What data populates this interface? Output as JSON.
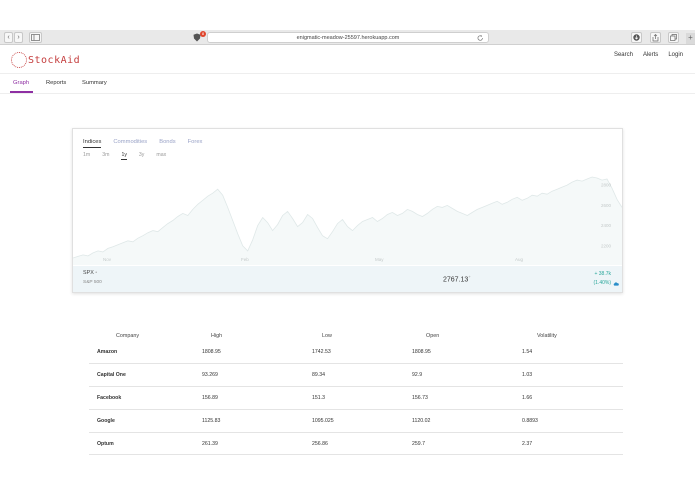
{
  "browser": {
    "url": "enigmatic-meadow-25597.herokuapp.com",
    "badge_count": "8",
    "back_glyph": "‹",
    "forward_glyph": "›",
    "new_tab_glyph": "+"
  },
  "app": {
    "logo_text": "StockAid",
    "top_links": [
      "Search",
      "Alerts",
      "Login"
    ]
  },
  "nav": {
    "tabs": [
      "Graph",
      "Reports",
      "Summary"
    ],
    "active_tab": "Graph"
  },
  "chart_card": {
    "categories": [
      "Indices",
      "Commodities",
      "Bonds",
      "Forex"
    ],
    "active_category": "Indices",
    "ranges": [
      "1m",
      "3m",
      "1y",
      "3y",
      "max"
    ],
    "active_range": "1y",
    "symbol": "SPX",
    "symbol_marker": "•",
    "symbol_name": "S&P 500",
    "last_price": "2767.13",
    "price_marker": "+",
    "change": "+ 38.7k",
    "change_pct": "(1.40%)",
    "accent_color": "#2aa79b"
  },
  "chart_data": {
    "type": "area",
    "title": "",
    "x_tick_labels": [
      "Nov",
      "Feb",
      "May",
      "Aug"
    ],
    "y_tick_labels": [
      "2800",
      "2600",
      "2400",
      "2200"
    ],
    "ylim": [
      2050,
      2900
    ],
    "values": [
      2080,
      2095,
      2110,
      2100,
      2130,
      2150,
      2140,
      2175,
      2190,
      2210,
      2230,
      2250,
      2240,
      2275,
      2300,
      2330,
      2350,
      2340,
      2380,
      2420,
      2450,
      2490,
      2520,
      2500,
      2560,
      2610,
      2650,
      2690,
      2720,
      2760,
      2700,
      2580,
      2450,
      2320,
      2200,
      2150,
      2260,
      2400,
      2480,
      2430,
      2350,
      2410,
      2500,
      2540,
      2470,
      2390,
      2430,
      2510,
      2470,
      2380,
      2300,
      2270,
      2340,
      2420,
      2460,
      2390,
      2350,
      2400,
      2440,
      2460,
      2480,
      2440,
      2470,
      2510,
      2530,
      2500,
      2520,
      2560,
      2540,
      2510,
      2490,
      2520,
      2560,
      2590,
      2580,
      2600,
      2570,
      2540,
      2520,
      2500,
      2530,
      2560,
      2580,
      2600,
      2620,
      2640,
      2610,
      2630,
      2660,
      2680,
      2650,
      2670,
      2700,
      2690,
      2720,
      2710,
      2740,
      2760,
      2780,
      2800,
      2830,
      2850,
      2840,
      2860,
      2880,
      2870,
      2850,
      2860,
      2770,
      2660,
      2580
    ],
    "grid": false,
    "legend": "none",
    "fill_color": "#f5f9f9",
    "line_color": "#dfe8e8"
  },
  "table": {
    "headers": [
      "Company",
      "High",
      "Low",
      "Open",
      "Volatility"
    ],
    "rows": [
      [
        "Amazon",
        "1808.95",
        "1742.53",
        "1808.95",
        "1.54"
      ],
      [
        "Capital One",
        "93.269",
        "89.34",
        "92.9",
        "1.03"
      ],
      [
        "Facebook",
        "156.89",
        "151.3",
        "156.73",
        "1.66"
      ],
      [
        "Google",
        "1125.83",
        "1095.025",
        "1120.02",
        "0.8893"
      ],
      [
        "Optum",
        "261.39",
        "256.86",
        "259.7",
        "2.37"
      ]
    ]
  }
}
